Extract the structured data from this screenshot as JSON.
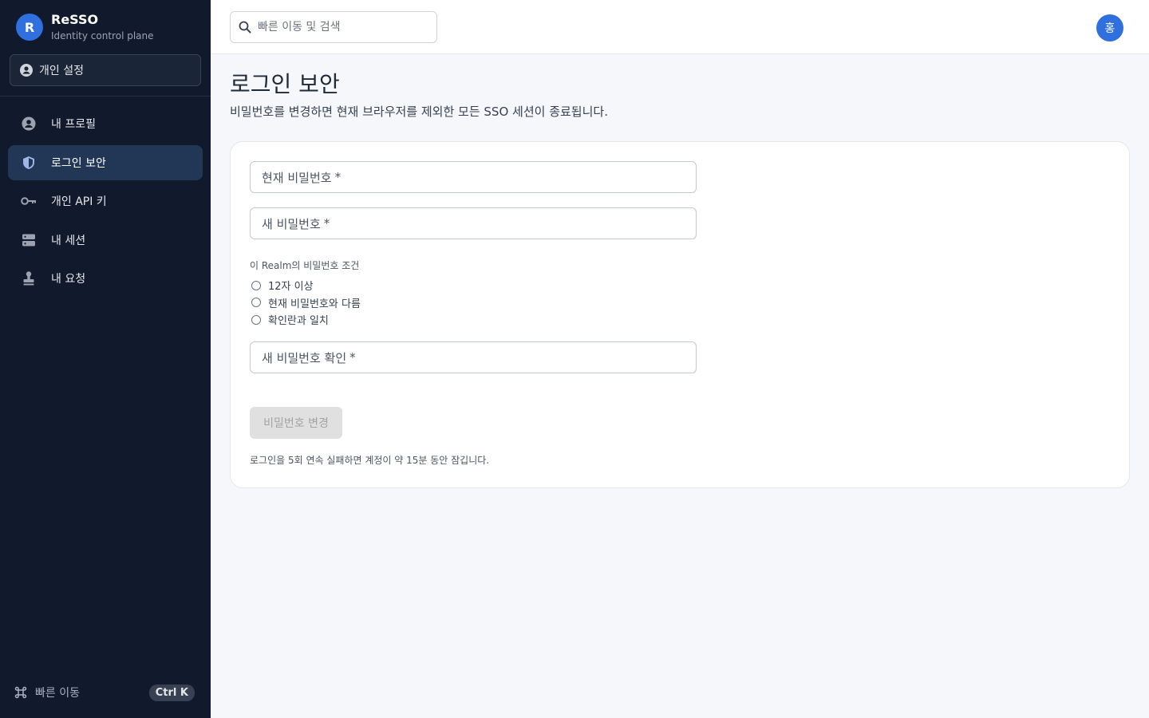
{
  "brand": {
    "logo_letter": "R",
    "name": "ReSSO",
    "subtitle": "Identity control plane"
  },
  "context_select": {
    "label": "개인 설정",
    "icon": "user-circle-icon"
  },
  "sidebar": {
    "items": [
      {
        "label": "내 프로필",
        "icon": "user-circle-icon",
        "active": false
      },
      {
        "label": "로그인 보안",
        "icon": "shield-icon",
        "active": true
      },
      {
        "label": "개인 API 키",
        "icon": "key-icon",
        "active": false
      },
      {
        "label": "내 세션",
        "icon": "server-icon",
        "active": false
      },
      {
        "label": "내 요청",
        "icon": "stamp-icon",
        "active": false
      }
    ],
    "footer": {
      "label": "빠른 이동",
      "icon": "command-icon",
      "shortcut": "Ctrl K"
    }
  },
  "topbar": {
    "search_placeholder": "빠른 이동 및 검색",
    "avatar_initial": "홍"
  },
  "main": {
    "title": "로그인 보안",
    "description": "비밀번호를 변경하면 현재 브라우저를 제외한 모든 SSO 세션이 종료됩니다.",
    "form": {
      "current_password_label": "현재 비밀번호",
      "new_password_label": "새 비밀번호",
      "confirm_password_label": "새 비밀번호 확인",
      "required_mark": "*",
      "rules_title": "이 Realm의 비밀번호 조건",
      "rules": [
        "12자 이상",
        "현재 비밀번호와 다름",
        "확인란과 일치"
      ],
      "submit_label": "비밀번호 변경",
      "lockout_note": "로그인을 5회 연속 실패하면 계정이 약 15분 동안 잠깁니다."
    }
  },
  "colors": {
    "sidebar_bg": "#111a2c",
    "accent": "#2f6fde",
    "active_item_bg": "#223656",
    "page_bg": "#f5f7fa"
  }
}
